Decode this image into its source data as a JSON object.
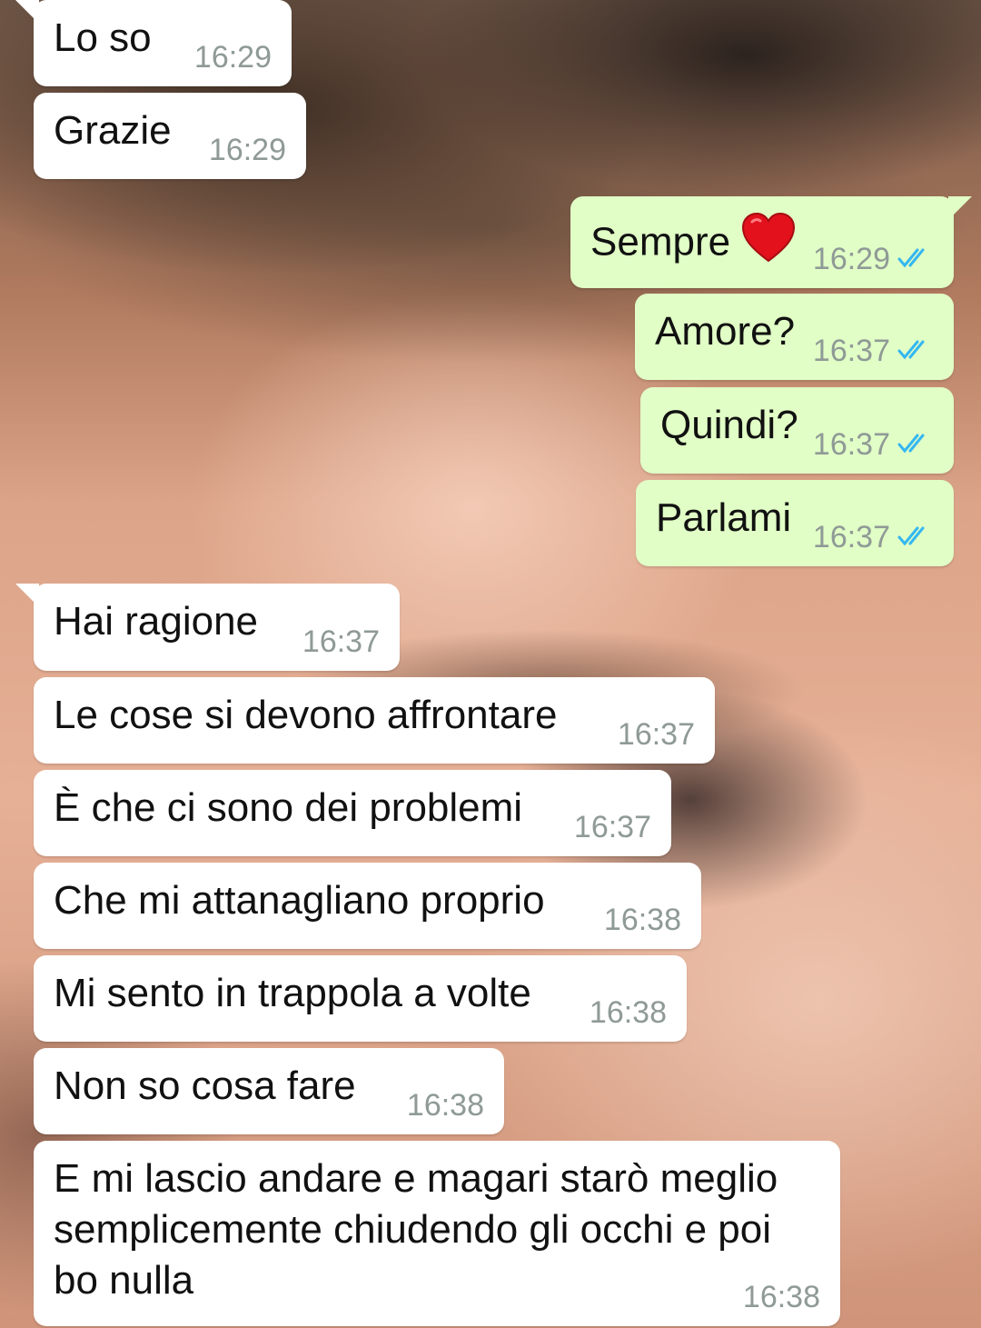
{
  "chat": {
    "messages": [
      {
        "direction": "in",
        "text": "Lo so",
        "time": "16:29"
      },
      {
        "direction": "in",
        "text": "Grazie",
        "time": "16:29"
      },
      {
        "direction": "out",
        "text": "Sempre",
        "emoji": "heart-emoji",
        "time": "16:29",
        "status": "read-double-check-icon"
      },
      {
        "direction": "out",
        "text": "Amore?",
        "time": "16:37",
        "status": "read-double-check-icon"
      },
      {
        "direction": "out",
        "text": "Quindi?",
        "time": "16:37",
        "status": "read-double-check-icon"
      },
      {
        "direction": "out",
        "text": "Parlami",
        "time": "16:37",
        "status": "read-double-check-icon"
      },
      {
        "direction": "in",
        "text": "Hai ragione",
        "time": "16:37"
      },
      {
        "direction": "in",
        "text": "Le cose si devono affrontare",
        "time": "16:37"
      },
      {
        "direction": "in",
        "text": "È che ci sono dei problemi",
        "time": "16:37"
      },
      {
        "direction": "in",
        "text": "Che mi attanagliano proprio",
        "time": "16:38"
      },
      {
        "direction": "in",
        "text": "Mi sento in trappola a volte",
        "time": "16:38"
      },
      {
        "direction": "in",
        "text": "Non so cosa fare",
        "time": "16:38"
      },
      {
        "direction": "in",
        "text": "E mi lascio andare e magari starò meglio semplicemente chiudendo gli occhi e poi bo nulla",
        "time": "16:38"
      }
    ]
  },
  "colors": {
    "incoming_bubble": "#ffffff",
    "outgoing_bubble": "#e1fec6",
    "timestamp": "#8f9a96",
    "read_ticks": "#34b7f1"
  }
}
